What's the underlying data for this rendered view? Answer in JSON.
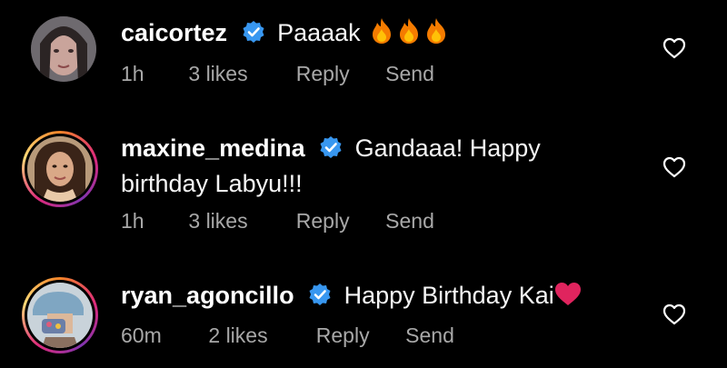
{
  "comments": [
    {
      "username": "caicortez",
      "verified": true,
      "text": "Paaaak",
      "emoji": [
        "fire",
        "fire",
        "fire"
      ],
      "time": "1h",
      "likes": "3 likes",
      "reply": "Reply",
      "send": "Send",
      "has_story_ring": false
    },
    {
      "username": "maxine_medina",
      "verified": true,
      "text_line1": "Gandaaa! Happy",
      "text_line2": "birthday Labyu!!!",
      "time": "1h",
      "likes": "3 likes",
      "reply": "Reply",
      "send": "Send",
      "has_story_ring": true
    },
    {
      "username": "ryan_agoncillo",
      "verified": true,
      "text": "Happy Birthday Kai",
      "emoji": [
        "red-heart"
      ],
      "time": "60m",
      "likes": "2 likes",
      "reply": "Reply",
      "send": "Send",
      "has_story_ring": true
    }
  ],
  "colors": {
    "background": "#000000",
    "verified_badge": "#3897f0",
    "meta_text": "#a8a8a8",
    "heart_emoji": "#e0245e"
  }
}
